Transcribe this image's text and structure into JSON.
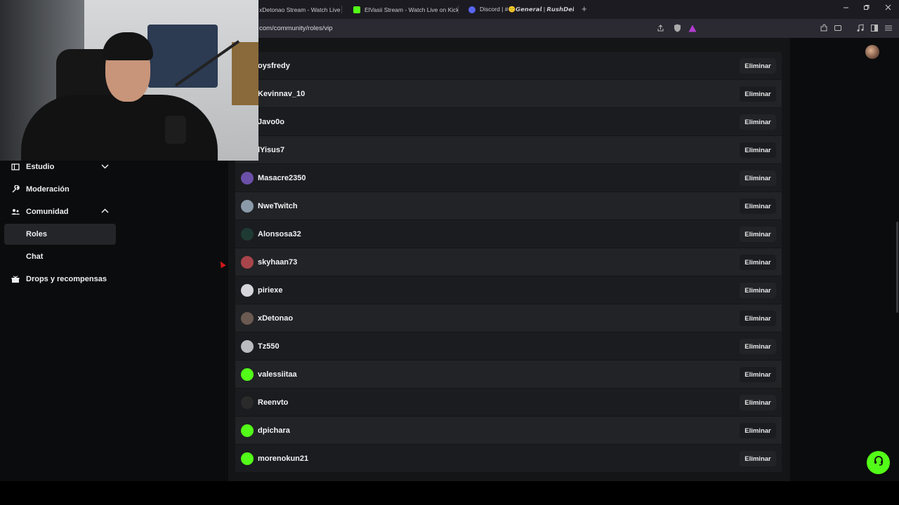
{
  "browser": {
    "tabs": [
      {
        "title": "xDetonao Stream - Watch Live on Kick",
        "icon": "kick-icon",
        "color": "#53fc18"
      },
      {
        "title": "ElVasii Stream - Watch Live on Kick",
        "icon": "kick-icon",
        "color": "#53fc18"
      },
      {
        "title": "Discord | #🙂𝙂𝙚𝙣𝙚𝙧𝙖𝙡 | 𝙍𝙪𝙨𝙝𝘿𝙚𝙠𝙪",
        "icon": "discord-icon",
        "color": "#5865f2"
      }
    ],
    "new_tab": "+",
    "url": "com/community/roles/vip"
  },
  "sidebar": {
    "items": [
      {
        "label": "Estudio",
        "icon": "studio-icon",
        "expandable": true,
        "expanded": false
      },
      {
        "label": "Moderación",
        "icon": "wrench-icon"
      },
      {
        "label": "Comunidad",
        "icon": "community-icon",
        "expandable": true,
        "expanded": true
      },
      {
        "label": "Roles",
        "sub": true,
        "active": true
      },
      {
        "label": "Chat",
        "sub": true
      },
      {
        "label": "Drops y recompensas",
        "icon": "gift-icon"
      }
    ]
  },
  "vip_list": {
    "remove_label": "Eliminar",
    "users": [
      {
        "name": "oysfredy",
        "avatar_color": "#3a3a3a"
      },
      {
        "name": "Kevinnav_10",
        "avatar_color": "#3a3a3a"
      },
      {
        "name": "Javo0o",
        "avatar_color": "#3a3a3a"
      },
      {
        "name": "lYisus7",
        "avatar_color": "#3a3a3a"
      },
      {
        "name": "Masacre2350",
        "avatar_color": "#6b4fa8"
      },
      {
        "name": "NweTwitch",
        "avatar_color": "#8a9aa8"
      },
      {
        "name": "Alonsosa32",
        "avatar_color": "#1e3a33"
      },
      {
        "name": "skyhaan73",
        "avatar_color": "#a8454a"
      },
      {
        "name": "piriexe",
        "avatar_color": "#d5d5db"
      },
      {
        "name": "xDetonao",
        "avatar_color": "#6a5a52"
      },
      {
        "name": "Tz550",
        "avatar_color": "#b9bbc0"
      },
      {
        "name": "valessiitaa",
        "avatar_color": "#53fc18"
      },
      {
        "name": "Reenvto",
        "avatar_color": "#2a2a2a"
      },
      {
        "name": "dpichara",
        "avatar_color": "#53fc18"
      },
      {
        "name": "morenokun21",
        "avatar_color": "#53fc18"
      }
    ]
  },
  "colors": {
    "accent": "#53fc18",
    "row_dark": "#1b1c1f",
    "row_light": "#222326"
  }
}
